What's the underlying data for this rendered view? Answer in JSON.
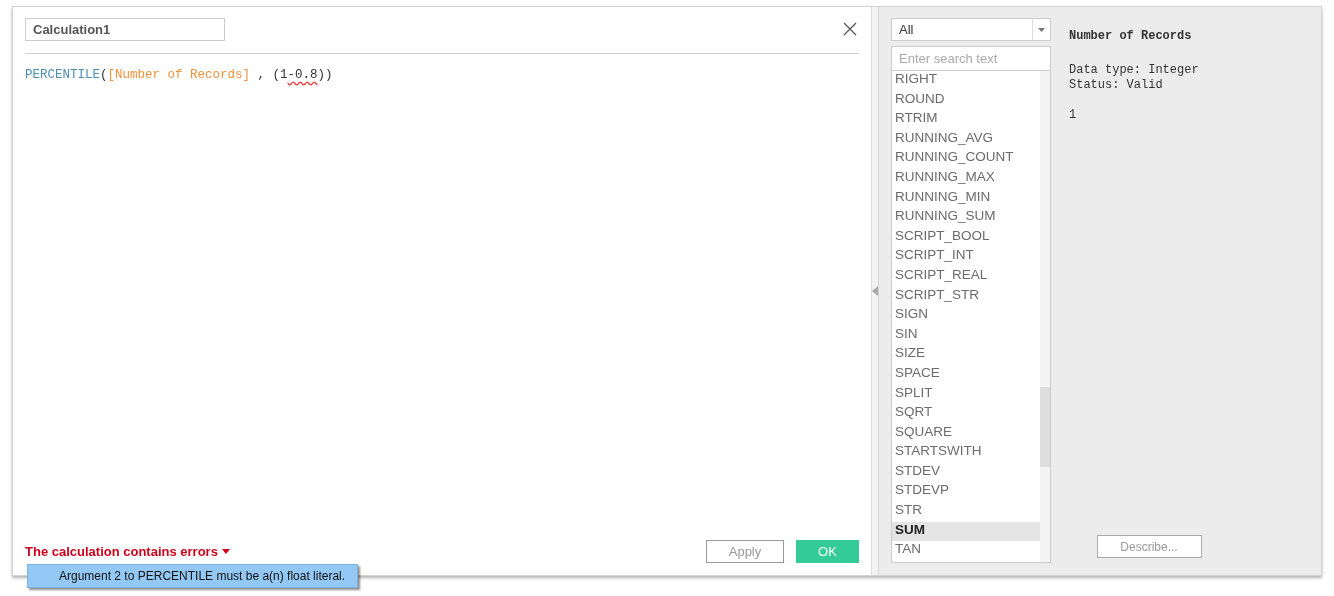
{
  "calculation_name": "Calculation1",
  "formula": [
    {
      "text": "PERCENTILE",
      "kind": "function"
    },
    {
      "text": "(",
      "kind": "plain"
    },
    {
      "text": "[Number of Records]",
      "kind": "field"
    },
    {
      "text": " , (1",
      "kind": "plain"
    },
    {
      "text": "-0.8",
      "kind": "error"
    },
    {
      "text": "))",
      "kind": "plain"
    }
  ],
  "status": {
    "message": "The calculation contains errors",
    "expanded": true
  },
  "error_tooltip": "Argument 2 to PERCENTILE must be a(n) float literal.",
  "buttons": {
    "apply": {
      "label": "Apply",
      "disabled": true
    },
    "ok": {
      "label": "OK"
    }
  },
  "category_select": "All",
  "search": {
    "placeholder": "Enter search text"
  },
  "functions": [
    {
      "name": "RIGHT",
      "selected": false
    },
    {
      "name": "ROUND",
      "selected": false
    },
    {
      "name": "RTRIM",
      "selected": false
    },
    {
      "name": "RUNNING_AVG",
      "selected": false
    },
    {
      "name": "RUNNING_COUNT",
      "selected": false
    },
    {
      "name": "RUNNING_MAX",
      "selected": false
    },
    {
      "name": "RUNNING_MIN",
      "selected": false
    },
    {
      "name": "RUNNING_SUM",
      "selected": false
    },
    {
      "name": "SCRIPT_BOOL",
      "selected": false
    },
    {
      "name": "SCRIPT_INT",
      "selected": false
    },
    {
      "name": "SCRIPT_REAL",
      "selected": false
    },
    {
      "name": "SCRIPT_STR",
      "selected": false
    },
    {
      "name": "SIGN",
      "selected": false
    },
    {
      "name": "SIN",
      "selected": false
    },
    {
      "name": "SIZE",
      "selected": false
    },
    {
      "name": "SPACE",
      "selected": false
    },
    {
      "name": "SPLIT",
      "selected": false
    },
    {
      "name": "SQRT",
      "selected": false
    },
    {
      "name": "SQUARE",
      "selected": false
    },
    {
      "name": "STARTSWITH",
      "selected": false
    },
    {
      "name": "STDEV",
      "selected": false
    },
    {
      "name": "STDEVP",
      "selected": false
    },
    {
      "name": "STR",
      "selected": false
    },
    {
      "name": "SUM",
      "selected": true
    },
    {
      "name": "TAN",
      "selected": false
    }
  ],
  "details": {
    "title": "Number of Records",
    "lines": [
      "Data type: Integer",
      "Status: Valid"
    ],
    "value": "1"
  },
  "describe_button": "Describe..."
}
